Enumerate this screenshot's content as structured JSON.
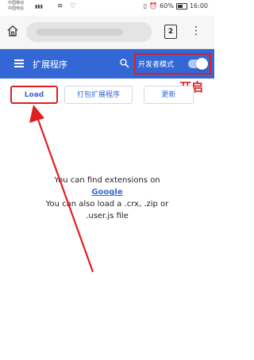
{
  "status_bar": {
    "carrier_line1": "中国移动",
    "carrier_line2": "中国电信",
    "battery": "60%",
    "time": "16:00"
  },
  "browser": {
    "tab_count": "2"
  },
  "header": {
    "title": "扩展程序",
    "developer_mode_label": "开发者模式",
    "developer_mode_on": true
  },
  "actions": {
    "load_label": "Load",
    "pack_label": "打包扩展程序",
    "update_label": "更新"
  },
  "empty_state": {
    "line1": "You can find extensions on",
    "link": "Google",
    "line2": "You can also load a .crx, .zip or",
    "line3": ".user.js file"
  },
  "annotation": {
    "label": "开启",
    "color": "#e02020"
  },
  "colors": {
    "header": "#3367d6",
    "link": "#3367d6"
  }
}
